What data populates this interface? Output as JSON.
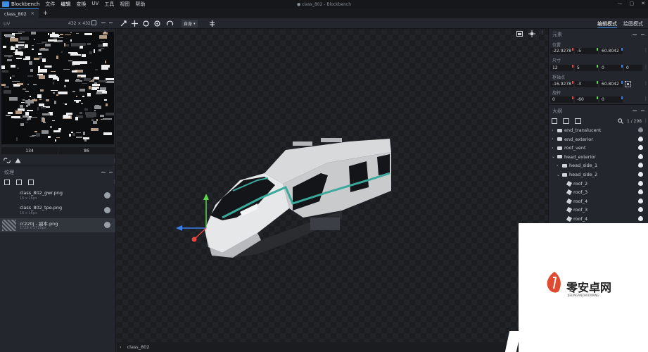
{
  "app": {
    "name": "Blockbench",
    "window_title": "● class_802 - Blockbench",
    "menu": [
      "文件",
      "编辑",
      "变换",
      "UV",
      "工具",
      "视图",
      "帮助"
    ],
    "window_controls": [
      "—",
      "▢",
      "✕"
    ]
  },
  "tabs": [
    {
      "label": "class_802",
      "close": "✕"
    }
  ],
  "new_tab": "+",
  "toolbar": {
    "space_select": "自身",
    "mode_edit": "编辑模式",
    "mode_paint": "绘图模式"
  },
  "uv_panel": {
    "title": "UV",
    "size": "432 × 432",
    "u_value": "134",
    "v_value": "86"
  },
  "textures": {
    "title": "纹理",
    "items": [
      {
        "name": "class_802_gwr.png",
        "size": "16 x 16px"
      },
      {
        "name": "class_802_tpe.png",
        "size": "16 x 16px"
      },
      {
        "name": "cr220j - 副本.png",
        "size": "1728 x 1728px"
      }
    ]
  },
  "element_panel": {
    "title": "元素",
    "position_label": "位置",
    "position": [
      "-22.9278",
      "-5",
      "60.8042"
    ],
    "size_label": "尺寸",
    "size": [
      "12",
      "5",
      "0",
      "0"
    ],
    "pivot_label": "枢轴点",
    "pivot": [
      "-16.9278",
      "-3",
      "60.8042"
    ],
    "rotation_label": "旋转",
    "rotation": [
      "0",
      "-60",
      "0"
    ]
  },
  "outliner": {
    "title": "大纲",
    "count": "1 / 298",
    "items": [
      {
        "label": "end_translucent",
        "type": "folder",
        "indent": 0,
        "arrow": "›"
      },
      {
        "label": "end_exterior",
        "type": "folder",
        "indent": 0,
        "arrow": "›"
      },
      {
        "label": "roof_vent",
        "type": "folder",
        "indent": 0,
        "arrow": "›"
      },
      {
        "label": "head_exterior",
        "type": "folder",
        "indent": 0,
        "arrow": "⌄"
      },
      {
        "label": "head_side_1",
        "type": "folder",
        "indent": 1,
        "arrow": "›"
      },
      {
        "label": "head_side_2",
        "type": "folder",
        "indent": 1,
        "arrow": "⌄"
      },
      {
        "label": "roof_2",
        "type": "cube",
        "indent": 2,
        "arrow": ""
      },
      {
        "label": "roof_3",
        "type": "cube",
        "indent": 2,
        "arrow": ""
      },
      {
        "label": "roof_4",
        "type": "cube",
        "indent": 2,
        "arrow": ""
      },
      {
        "label": "roof_3",
        "type": "cube",
        "indent": 2,
        "arrow": ""
      },
      {
        "label": "roof_4",
        "type": "cube",
        "indent": 2,
        "arrow": ""
      }
    ]
  },
  "statusbar": {
    "label": "class_802",
    "arrow": "‹"
  },
  "colors": {
    "accent": "#3a8ee6",
    "x_axis": "#e8473f",
    "y_axis": "#5bd94a",
    "z_axis": "#3f7fe8",
    "train_stripe": "#3aa89a"
  },
  "watermark": {
    "brand": "零安卓网",
    "sub": "JIELINGANZHUOWANG"
  }
}
